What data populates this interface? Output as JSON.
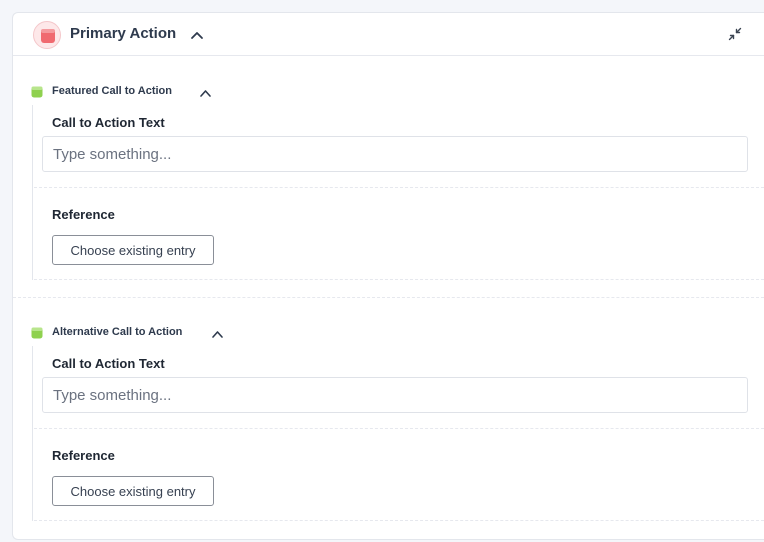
{
  "header": {
    "title": "Primary Action",
    "icon": "stack-icon",
    "icon_color": "#f06a70"
  },
  "sections": [
    {
      "title": "Featured Call to Action",
      "icon": "entry-icon",
      "icon_color": "#8fd14f",
      "field_label": "Call to Action Text",
      "input_placeholder": "Type something...",
      "reference_label": "Reference",
      "button_label": "Choose existing entry"
    },
    {
      "title": "Alternative Call to Action",
      "icon": "entry-icon",
      "icon_color": "#8fd14f",
      "field_label": "Call to Action Text",
      "input_placeholder": "Type something...",
      "reference_label": "Reference",
      "button_label": "Choose existing entry"
    }
  ]
}
